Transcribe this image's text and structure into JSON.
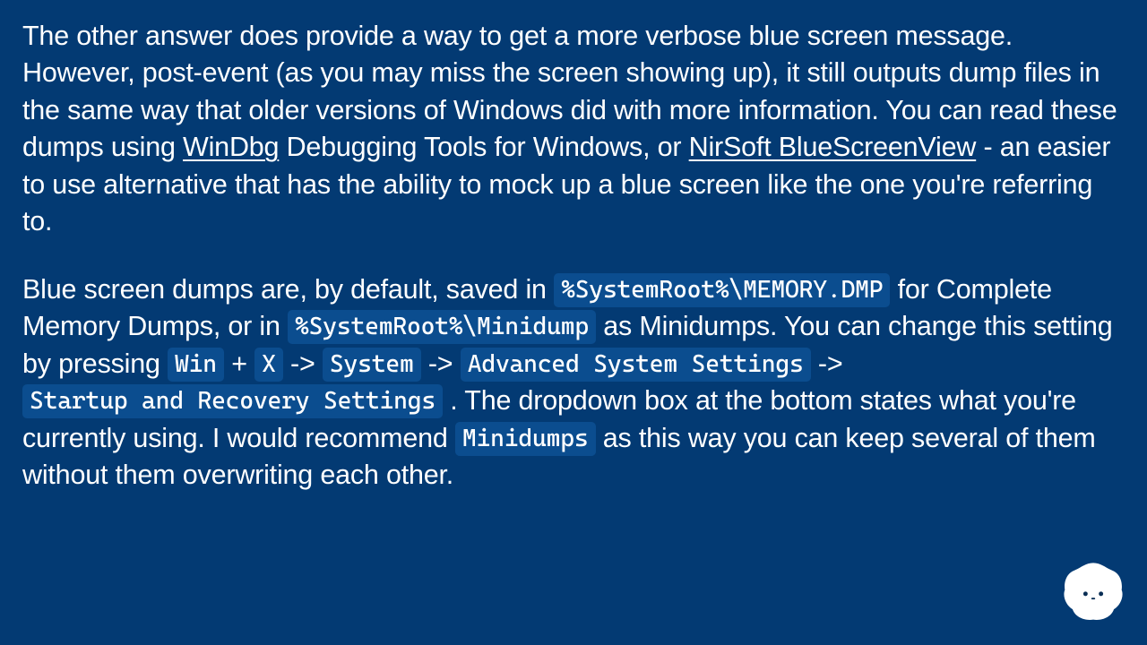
{
  "para1": {
    "s1": "The other answer does provide a way to get a more verbose blue screen message. However, post-event (as you may miss the screen showing up), it still outputs dump files in the same way that older versions of Windows did with more information. You can read these dumps using ",
    "link1": "WinDbg",
    "s2": " Debugging Tools for Windows, or ",
    "link2": "NirSoft BlueScreenView",
    "s3": " - an easier to use alternative that has the ability to mock up a blue screen like the one you're referring to."
  },
  "para2": {
    "s1": "Blue screen dumps are, by default, saved in ",
    "c1": "%SystemRoot%\\MEMORY.DMP",
    "s2": " for Complete Memory Dumps, or in ",
    "c2": "%SystemRoot%\\Minidump",
    "s3": " as Minidumps. You can change this setting by pressing ",
    "k1": "Win",
    "plus": " + ",
    "k2": "X",
    "arrow1": " -> ",
    "k3": "System",
    "arrow2": " -> ",
    "k4": "Advanced System Settings",
    "arrow3": " -> ",
    "k5": "Startup and Recovery Settings",
    "s4": " . The dropdown box at the bottom states what you're currently using. I would recommend ",
    "c3": "Minidumps",
    "s5": " as this way you can keep several of them without them overwriting each other."
  }
}
